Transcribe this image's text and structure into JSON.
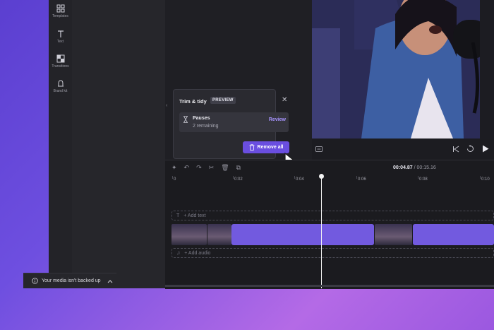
{
  "sidebar": {
    "items": [
      {
        "label": "Templates",
        "icon": "templates-icon"
      },
      {
        "label": "Text",
        "icon": "text-icon"
      },
      {
        "label": "Transitions",
        "icon": "transitions-icon"
      },
      {
        "label": "Brand kit",
        "icon": "brand-kit-icon"
      }
    ]
  },
  "backup": {
    "label": "Your media isn't backed up"
  },
  "popup": {
    "title": "Trim & tidy",
    "badge": "PREVIEW",
    "item_title": "Pauses",
    "item_sub": "2 remaining",
    "review_label": "Review",
    "remove_label": "Remove all"
  },
  "timeline": {
    "current": "00:04.87",
    "total": "/ 00:15.16",
    "ticks": [
      "0",
      "0:02",
      "0:04",
      "0:06",
      "0:08",
      "0:10"
    ],
    "text_track": "+ Add text",
    "audio_track": "+ Add audio"
  },
  "colors": {
    "accent": "#6a4ee0",
    "clip": "#7a5ff0"
  }
}
